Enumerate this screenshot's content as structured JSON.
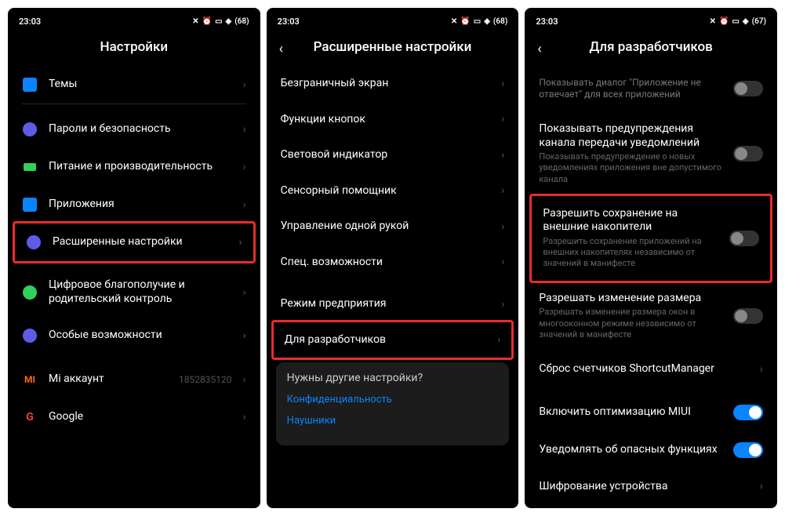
{
  "status": {
    "time": "23:03",
    "battery1": "68",
    "battery2": "67"
  },
  "screens": [
    {
      "title": "Настройки",
      "back": false,
      "groups": [
        [
          {
            "icon": "themes",
            "iconColor": "#0a84ff",
            "label": "Темы",
            "chev": true
          }
        ],
        [
          {
            "icon": "lock",
            "iconColor": "#5e5ce6",
            "label": "Пароли и безопасность",
            "chev": true
          },
          {
            "icon": "battery",
            "iconColor": "#30d158",
            "label": "Питание и производительность",
            "chev": true
          },
          {
            "icon": "apps",
            "iconColor": "#0a84ff",
            "label": "Приложения",
            "chev": true
          },
          {
            "icon": "more",
            "iconColor": "#5e5ce6",
            "label": "Расширенные настройки",
            "chev": true,
            "highlight": true
          }
        ],
        [
          {
            "icon": "family",
            "iconColor": "#30d158",
            "label": "Цифровое благополучие и родительский контроль",
            "chev": true
          },
          {
            "icon": "access",
            "iconColor": "#5e5ce6",
            "label": "Особые возможности",
            "chev": true
          }
        ],
        [
          {
            "icon": "mi",
            "iconColor": "#ff6b00",
            "label": "Mi аккаунт",
            "meta": "1852835120",
            "chev": true
          },
          {
            "icon": "google",
            "iconColor": "#fff",
            "label": "Google",
            "chev": true
          }
        ]
      ]
    },
    {
      "title": "Расширенные настройки",
      "back": true,
      "groups": [
        [
          {
            "label": "Безграничный экран",
            "chev": true
          },
          {
            "label": "Функции кнопок",
            "chev": true
          },
          {
            "label": "Световой индикатор",
            "chev": true
          },
          {
            "label": "Сенсорный помощник",
            "chev": true
          },
          {
            "label": "Управление одной рукой",
            "chev": true
          },
          {
            "label": "Спец. возможности",
            "chev": true
          }
        ],
        [
          {
            "label": "Режим предприятия",
            "chev": true
          },
          {
            "label": "Для разработчиков",
            "chev": true,
            "highlight": true
          }
        ]
      ],
      "footer": {
        "title": "Нужны другие настройки?",
        "links": [
          "Конфиденциальность",
          "Наушники"
        ]
      }
    },
    {
      "title": "Для разработчиков",
      "back": true,
      "groups": [
        [
          {
            "label": "Показывать диалог \"Приложение не отвечает\" для всех приложений",
            "toggle": false,
            "dim": true
          },
          {
            "label": "Показывать предупреждения канала передачи уведомлений",
            "sub": "Показывать предупреждение о новых уведомлениях приложения вне допустимого канала",
            "toggle": false
          },
          {
            "label": "Разрешить сохранение на внешние накопители",
            "sub": "Разрешить сохранение приложений на внешних накопителях независимо от значений в манифесте",
            "toggle": false,
            "highlight": true
          },
          {
            "label": "Разрешать изменение размера",
            "sub": "Разрешать изменение размера окон в многооконном режиме независимо от значений в манифесте",
            "toggle": false
          },
          {
            "label": "Сброс счетчиков ShortcutManager",
            "chev": true
          }
        ],
        [
          {
            "label": "Включить оптимизацию MIUI",
            "toggle": true
          },
          {
            "label": "Уведомлять об опасных функциях",
            "toggle": true
          },
          {
            "label": "Шифрование устройства",
            "chev": true
          }
        ]
      ]
    }
  ]
}
